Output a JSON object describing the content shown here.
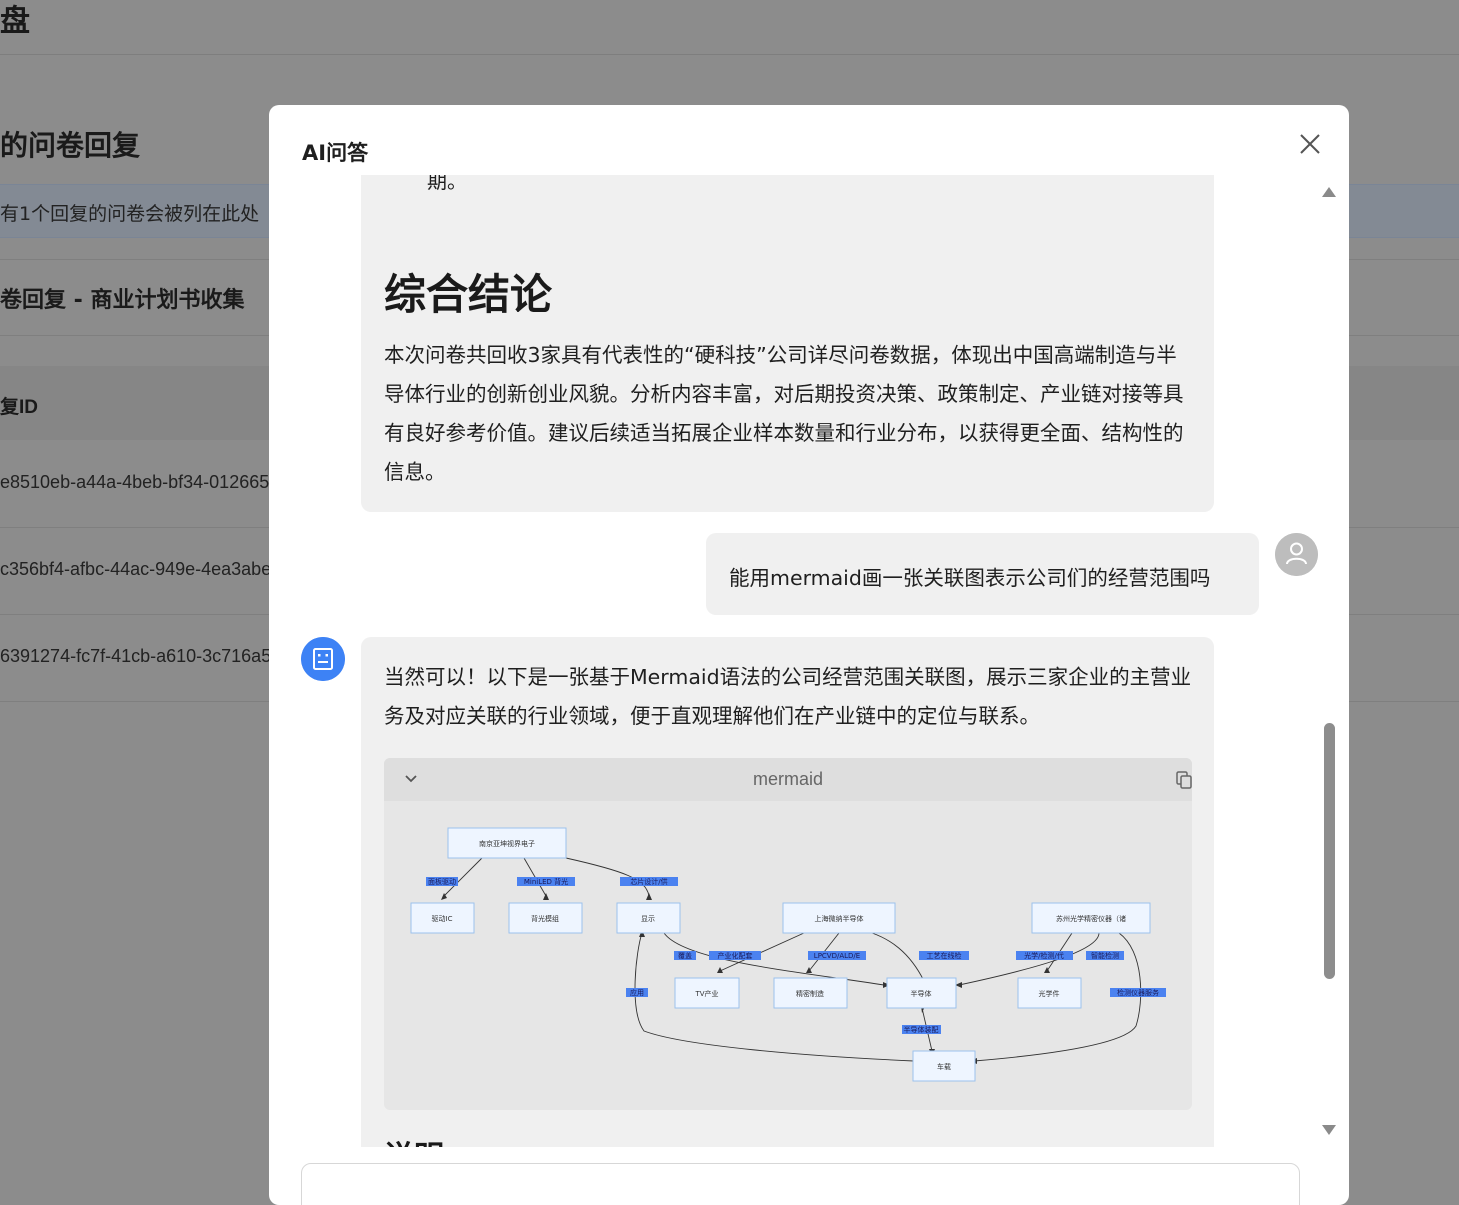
{
  "background": {
    "header_title": "盘",
    "section_title": "的问卷回复",
    "info_text": "有1个回复的问卷会被列在此处",
    "card_title": "卷回复 - 商业计划书收集",
    "table_header": "复ID",
    "rows": [
      "e8510eb-a44a-4beb-bf34-012665",
      "c356bf4-afbc-44ac-949e-4ea3abe",
      "6391274-fc7f-41cb-a610-3c716a5"
    ]
  },
  "modal": {
    "title": "AI问答",
    "close_icon": "close-icon"
  },
  "messages": {
    "truncated_line": "期。",
    "conclusion_heading": "综合结论",
    "conclusion_text": "本次问卷共回收3家具有代表性的“硬科技”公司详尽问卷数据，体现出中国高端制造与半导体行业的创新创业风貌。分析内容丰富，对后期投资决策、政策制定、产业链对接等具有良好参考价值。建议后续适当拓展企业样本数量和行业分布，以获得更全面、结构性的信息。",
    "user_question": "能用mermaid画一张关联图表示公司们的经营范围吗",
    "bot_intro": "当然可以！以下是一张基于Mermaid语法的公司经营范围关联图，展示三家企业的主营业务及对应关联的行业领域，便于直观理解他们在产业链中的定位与联系。",
    "code_lang": "mermaid",
    "next_heading": "说明"
  },
  "diagram": {
    "nodes": [
      "南京亚坤视界电子",
      "驱动IC",
      "背光模组",
      "显示",
      "上海微纳半导体",
      "TV产业",
      "精密制造",
      "半导体",
      "苏州光学精密仪器（诸",
      "光学件",
      "车载"
    ],
    "edge_labels": [
      "面板驱动",
      "MiniLED 背光",
      "芯片设计/供",
      "覆盖",
      "产业化配套",
      "LPCVD/ALD/E",
      "工艺在线检",
      "光学/检测/代",
      "智能检测",
      "应用",
      "检测仪器服务",
      "半导体装配"
    ]
  },
  "colors": {
    "accent": "#3d82f5",
    "bubble": "#f0f0f0",
    "overlay": "#8c8c8c"
  }
}
